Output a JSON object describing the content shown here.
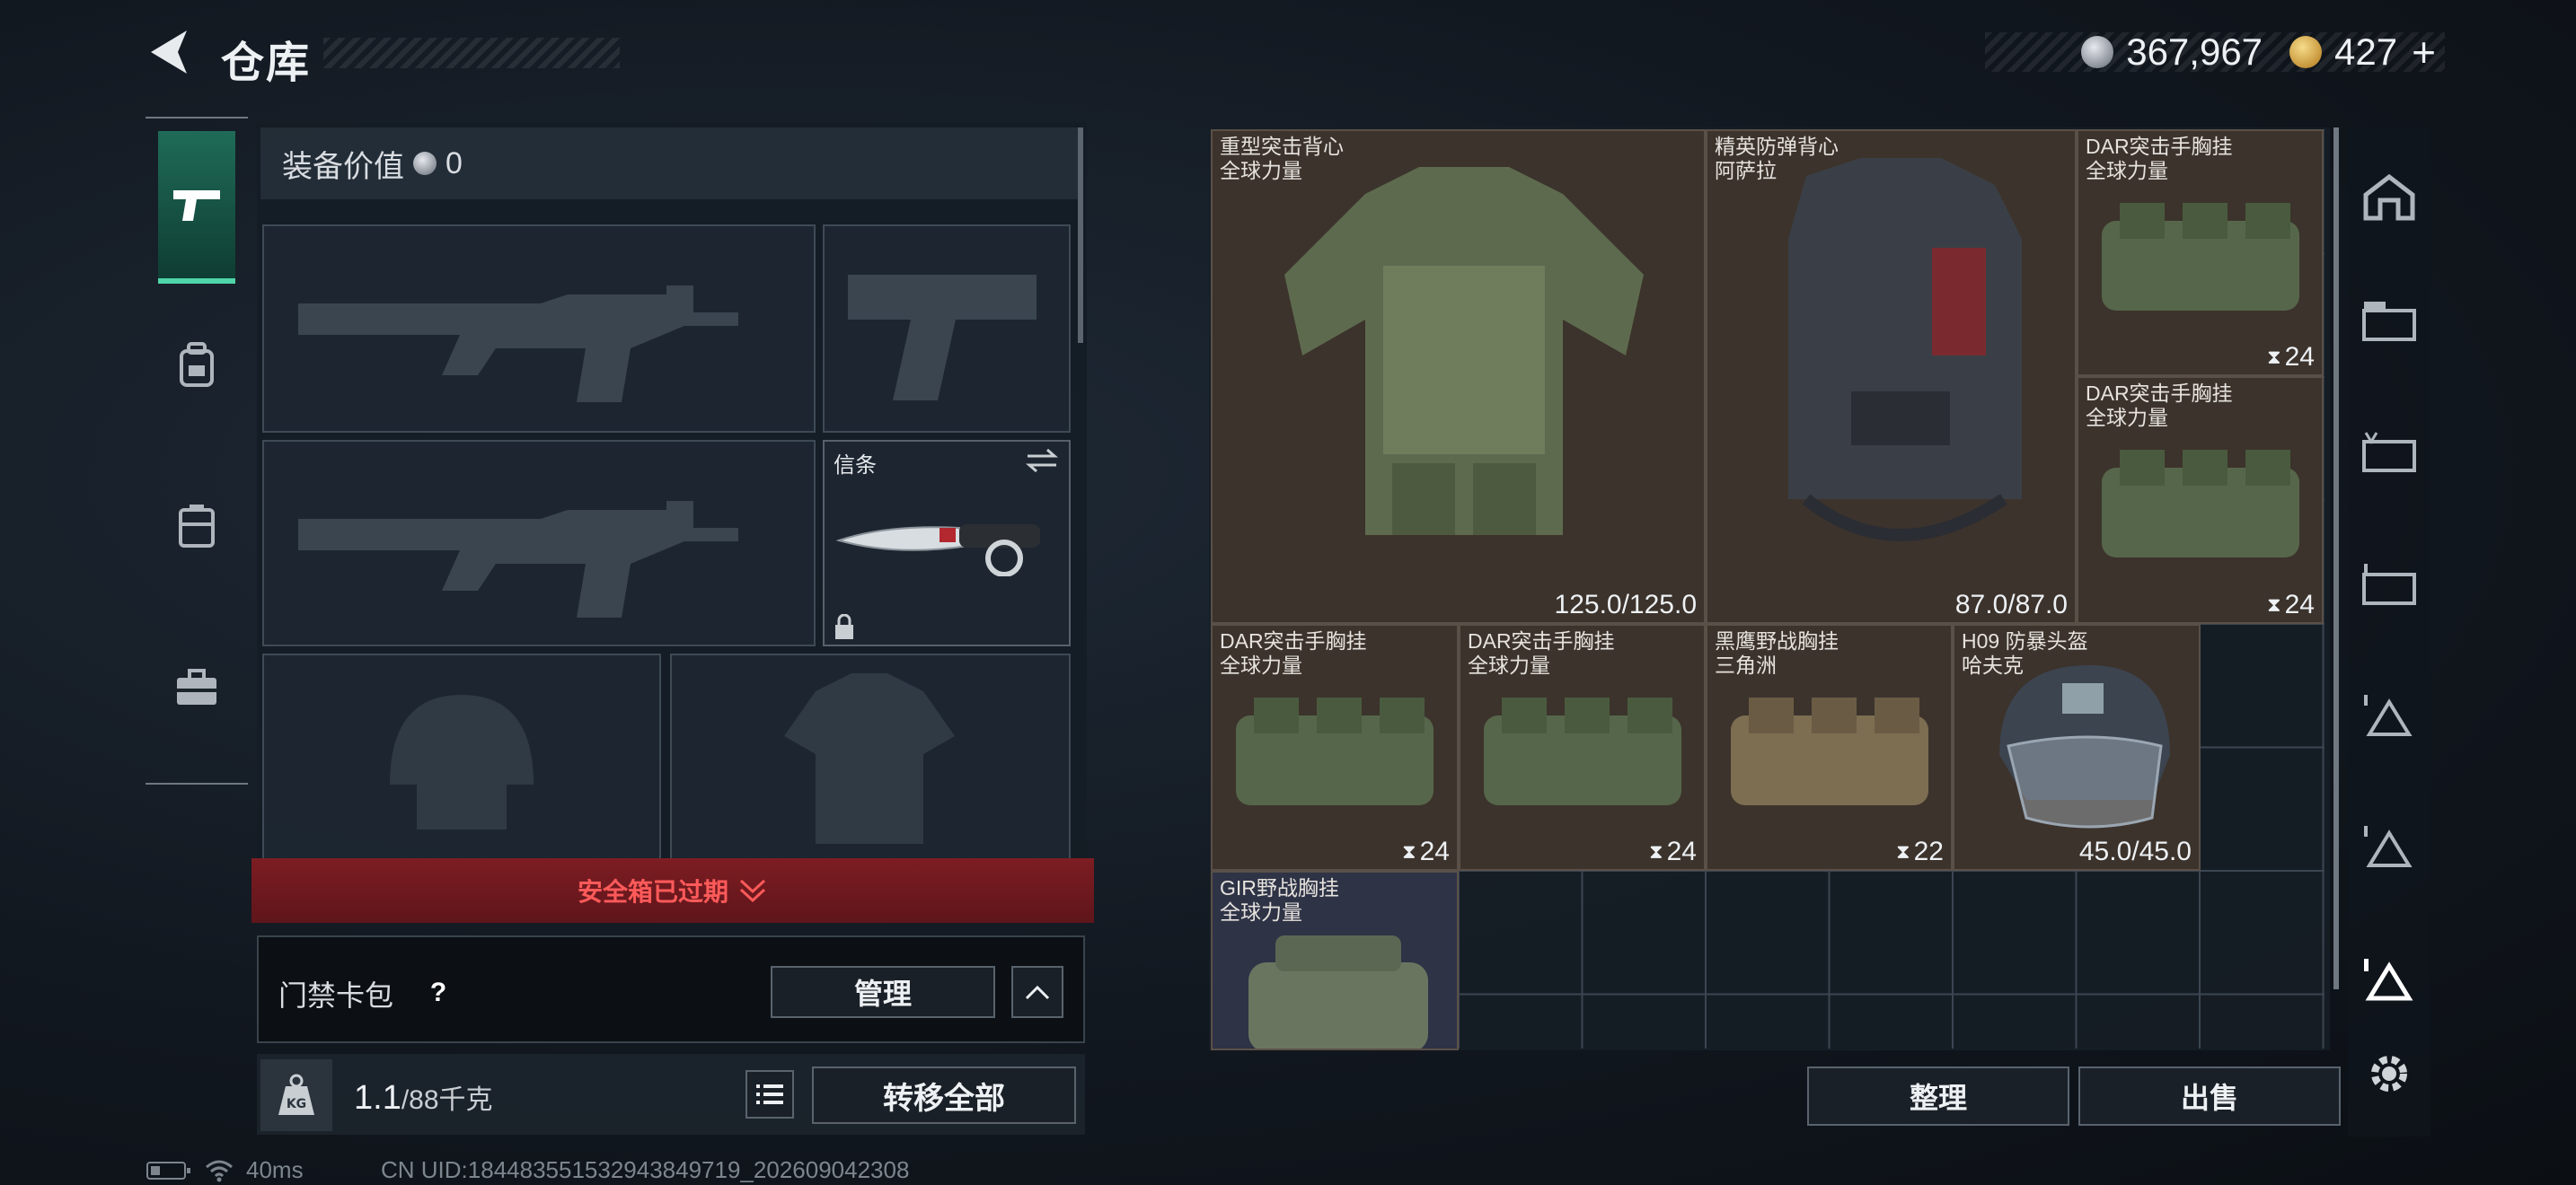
{
  "header": {
    "title": "仓库",
    "currency_silver": "367,967",
    "currency_gold": "427",
    "add_symbol": "+"
  },
  "loadout": {
    "equip_value_label": "装备价值",
    "equip_value": "0",
    "melee_slot_label": "信条",
    "safe_box_status": "安全箱已过期",
    "keycard_case_label": "门禁卡包",
    "help_symbol": "?",
    "manage_button": "管理",
    "weight_current": "1.1",
    "weight_max": "/88千克",
    "weight_icon_text": "KG",
    "transfer_all_button": "转移全部"
  },
  "stash": {
    "items": [
      {
        "name": "重型突击背心",
        "sub": "全球力量",
        "value": "125.0/125.0",
        "kind": "durability"
      },
      {
        "name": "精英防弹背心",
        "sub": "阿萨拉",
        "value": "87.0/87.0",
        "kind": "durability"
      },
      {
        "name": "DAR突击手胸挂",
        "sub": "全球力量",
        "value": "24",
        "kind": "capacity"
      },
      {
        "name": "DAR突击手胸挂",
        "sub": "全球力量",
        "value": "24",
        "kind": "capacity"
      },
      {
        "name": "DAR突击手胸挂",
        "sub": "全球力量",
        "value": "24",
        "kind": "capacity"
      },
      {
        "name": "DAR突击手胸挂",
        "sub": "全球力量",
        "value": "24",
        "kind": "capacity"
      },
      {
        "name": "黑鹰野战胸挂",
        "sub": "三角洲",
        "value": "22",
        "kind": "capacity"
      },
      {
        "name": "H09 防暴头盔",
        "sub": "哈夫克",
        "value": "45.0/45.0",
        "kind": "durability"
      },
      {
        "name": "GIR野战胸挂",
        "sub": "全球力量",
        "value": "",
        "kind": "capacity"
      }
    ],
    "sort_button": "整理",
    "sell_button": "出售"
  },
  "status": {
    "ping": "40ms",
    "uid": "CN UID:18448355153294384​9719_202609042308"
  },
  "colors": {
    "accent_green": "#4fd5a8",
    "expired_red": "#ff5a5a",
    "item_brown": "#3c332c"
  }
}
